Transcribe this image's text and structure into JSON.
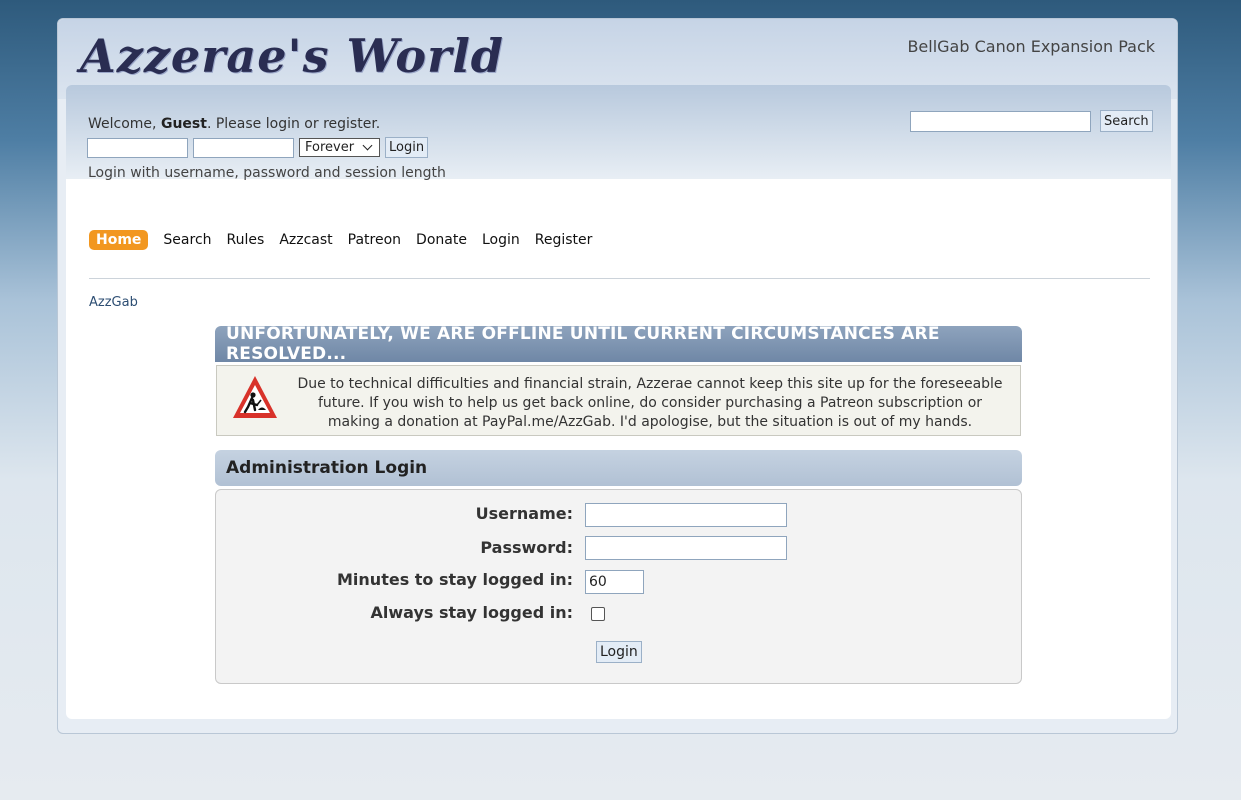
{
  "header": {
    "logo": "Azzerae's World",
    "tagline": "BellGab Canon Expansion Pack"
  },
  "userbar": {
    "welcome_prefix": "Welcome, ",
    "guest": "Guest",
    "welcome_mid": ". Please ",
    "login_link": "login",
    "or": " or ",
    "register_link": "register",
    "period": ".",
    "session_option": "Forever",
    "login_button": "Login",
    "hint": "Login with username, password and session length"
  },
  "search": {
    "button": "Search"
  },
  "menu": {
    "items": [
      "Home",
      "Search",
      "Rules",
      "Azzcast",
      "Patreon",
      "Donate",
      "Login",
      "Register"
    ]
  },
  "breadcrumb": {
    "item": "AzzGab"
  },
  "offline": {
    "title": "UNFORTUNATELY, WE ARE OFFLINE UNTIL CURRENT CIRCUMSTANCES ARE RESOLVED...",
    "message": "Due to technical difficulties and financial strain, Azzerae cannot keep this site up for the foreseeable future. If you wish to help us get back online, do consider purchasing a Patreon subscription or making a donation at PayPal.me/AzzGab. I'd apologise, but the situation is out of my hands."
  },
  "admin": {
    "title": "Administration Login",
    "username_label": "Username:",
    "password_label": "Password:",
    "minutes_label": "Minutes to stay logged in:",
    "minutes_value": "60",
    "always_label": "Always stay logged in:",
    "login_button": "Login"
  },
  "colors": {
    "accent": "#f29720",
    "catbar": "#7f95b1"
  }
}
